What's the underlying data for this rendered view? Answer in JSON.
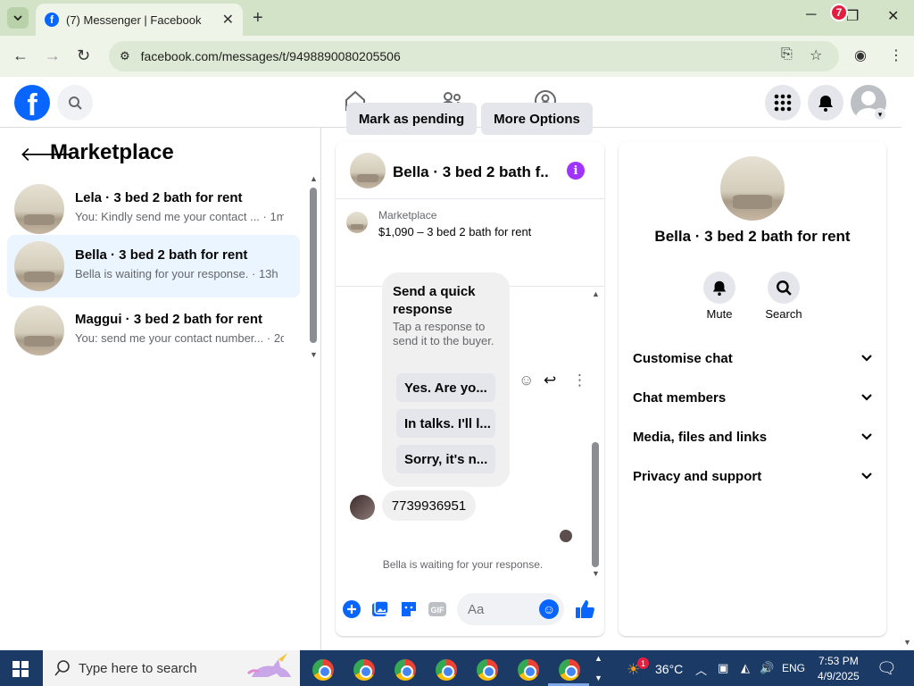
{
  "browser": {
    "tab_title": "(7) Messenger | Facebook",
    "url": "facebook.com/messages/t/9498890080205506"
  },
  "header": {
    "notification_count": "7"
  },
  "left": {
    "title": "Marketplace",
    "conversations": [
      {
        "name": "Lela · 3 bed 2 bath for rent",
        "preview": "You: Kindly send me your contact ...",
        "time": "· 1m"
      },
      {
        "name": "Bella · 3 bed 2 bath for rent",
        "preview": "Bella is waiting for your response.",
        "time": "· 13h"
      },
      {
        "name": "Maggui · 3 bed 2 bath for rent",
        "preview": "You: send me your contact number...",
        "time": "· 2d"
      }
    ]
  },
  "chat": {
    "title": "Bella · 3 bed 2 bath f...",
    "listing_source": "Marketplace",
    "listing_price": "$1,090 – 3 bed 2 bath for rent",
    "mark_pending": "Mark as pending",
    "more_options": "More Options",
    "quick_title": "Send a quick response",
    "quick_sub": "Tap a response to send it to the buyer.",
    "quick_options": [
      "Yes. Are yo...",
      "In talks. I'll l...",
      "Sorry, it's n..."
    ],
    "phone_message": "7739936951",
    "waiting": "Bella is waiting for your response.",
    "input_placeholder": "Aa"
  },
  "right": {
    "name": "Bella · 3 bed 2 bath for rent",
    "mute": "Mute",
    "search": "Search",
    "rows": [
      "Customise chat",
      "Chat members",
      "Media, files and links",
      "Privacy and support"
    ]
  },
  "taskbar": {
    "search_placeholder": "Type here to search",
    "weather_badge": "1",
    "temperature": "36°C",
    "language": "ENG",
    "time": "7:53 PM",
    "date": "4/9/2025"
  },
  "colors": {
    "fb_blue": "#0866ff",
    "active_row": "#ebf5ff",
    "info_purple": "#a033ff",
    "badge_red": "#e41e3f"
  }
}
